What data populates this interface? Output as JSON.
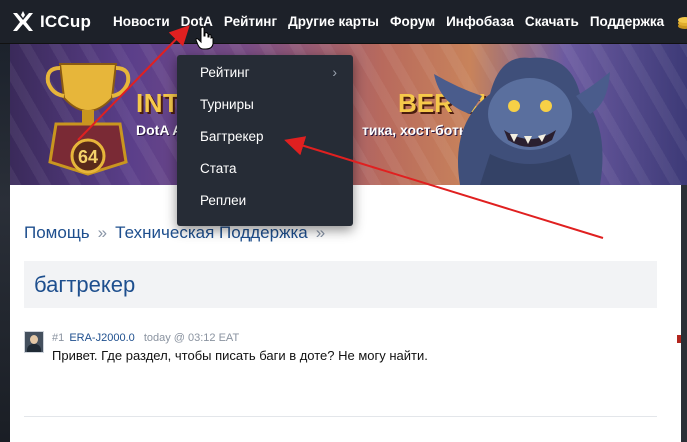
{
  "logo": {
    "text": "ICCup"
  },
  "nav": {
    "items": [
      {
        "label": "Новости"
      },
      {
        "label": "DotA"
      },
      {
        "label": "Рейтинг"
      },
      {
        "label": "Другие карты"
      },
      {
        "label": "Форум"
      },
      {
        "label": "Инфобаза"
      },
      {
        "label": "Скачать"
      },
      {
        "label": "Поддержка"
      }
    ]
  },
  "banner": {
    "title_left": "INT",
    "title_right": "BER CUP",
    "sub_left": "DotA A",
    "sub_right": "тика, хост-боты",
    "trophy_number": "64"
  },
  "dropdown": {
    "items": [
      {
        "label": "Рейтинг"
      },
      {
        "label": "Турниры"
      },
      {
        "label": "Багтрекер"
      },
      {
        "label": "Стата"
      },
      {
        "label": "Реплеи"
      }
    ]
  },
  "breadcrumb": {
    "items": [
      "Помощь",
      "Техническая Поддержка"
    ],
    "separator": "»"
  },
  "page": {
    "title": "багтрекер"
  },
  "post": {
    "number": "#1",
    "author": "ERA-J2000.0",
    "time": "today @ 03:12 EAT",
    "text": "Привет. Где раздел, чтобы писать баги в доте? Не могу найти."
  },
  "colors": {
    "nav_bg": "#1d2129",
    "dropdown_bg": "#262c36",
    "link": "#1e4f8e",
    "banner_gold": "#f6c94a",
    "annotation_red": "#e02020"
  }
}
